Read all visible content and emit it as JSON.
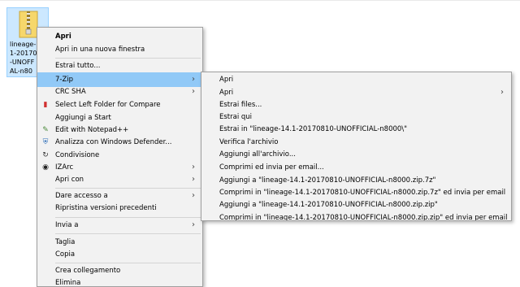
{
  "file": {
    "name_lines": [
      "lineage-1",
      "1-20170",
      "-UNOFF",
      "AL-n80"
    ]
  },
  "context_menu": {
    "items": [
      {
        "label": "Apri"
      },
      {
        "label": "Apri in una nuova finestra"
      },
      {
        "label": "Estrai tutto..."
      },
      {
        "label": "7-Zip"
      },
      {
        "label": "CRC SHA"
      },
      {
        "label": "Select Left Folder for Compare"
      },
      {
        "label": "Aggiungi a Start"
      },
      {
        "label": "Edit with Notepad++"
      },
      {
        "label": "Analizza con Windows Defender..."
      },
      {
        "label": "Condivisione"
      },
      {
        "label": "IZArc"
      },
      {
        "label": "Apri con"
      },
      {
        "label": "Dare accesso a"
      },
      {
        "label": "Ripristina versioni precedenti"
      },
      {
        "label": "Invia a"
      },
      {
        "label": "Taglia"
      },
      {
        "label": "Copia"
      },
      {
        "label": "Crea collegamento"
      },
      {
        "label": "Elimina"
      }
    ]
  },
  "submenu_7zip": {
    "items": [
      {
        "label": "Apri"
      },
      {
        "label": "Apri"
      },
      {
        "label": "Estrai files..."
      },
      {
        "label": "Estrai qui"
      },
      {
        "label": "Estrai in \"lineage-14.1-20170810-UNOFFICIAL-n8000\\\""
      },
      {
        "label": "Verifica l'archivio"
      },
      {
        "label": "Aggiungi all'archivio..."
      },
      {
        "label": "Comprimi ed invia per email..."
      },
      {
        "label": "Aggiungi a \"lineage-14.1-20170810-UNOFFICIAL-n8000.zip.7z\""
      },
      {
        "label": "Comprimi in \"lineage-14.1-20170810-UNOFFICIAL-n8000.zip.7z\" ed invia per email"
      },
      {
        "label": "Aggiungi a \"lineage-14.1-20170810-UNOFFICIAL-n8000.zip.zip\""
      },
      {
        "label": "Comprimi in \"lineage-14.1-20170810-UNOFFICIAL-n8000.zip.zip\" ed invia per email"
      }
    ]
  },
  "colors": {
    "highlight": "#91c9f7",
    "menu_bg": "#f2f2f2",
    "selection_bg": "#cce8ff"
  },
  "icons": {
    "file": "zip-folder-icon",
    "submenu_arrow": "chevron-right-icon"
  }
}
